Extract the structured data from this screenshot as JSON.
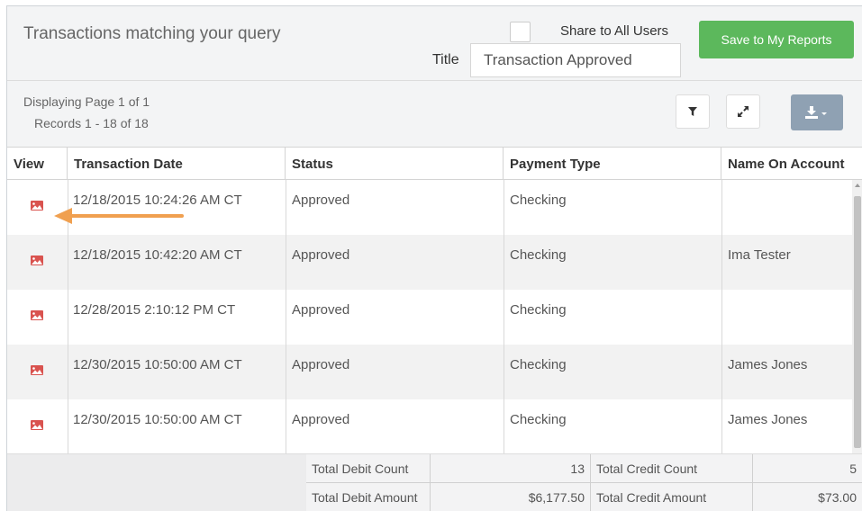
{
  "header": {
    "title": "Transactions matching your query",
    "share_label": "Share to All Users",
    "title_label": "Title",
    "title_value": "Transaction Approved",
    "save_button": "Save to My Reports"
  },
  "pagination": {
    "page_text": "Displaying Page 1 of 1",
    "records_text": "Records 1 - 18 of 18"
  },
  "toolbar": {
    "filter_icon": "filter-icon",
    "expand_icon": "expand-icon",
    "download_icon": "download-icon"
  },
  "table": {
    "columns": [
      "View",
      "Transaction Date",
      "Status",
      "Payment Type",
      "Name On Account"
    ],
    "rows": [
      {
        "date": "12/18/2015 10:24:26 AM CT",
        "status": "Approved",
        "payment": "Checking",
        "name": ""
      },
      {
        "date": "12/18/2015 10:42:20 AM CT",
        "status": "Approved",
        "payment": "Checking",
        "name": "Ima Tester"
      },
      {
        "date": "12/28/2015 2:10:12 PM CT",
        "status": "Approved",
        "payment": "Checking",
        "name": ""
      },
      {
        "date": "12/30/2015 10:50:00 AM CT",
        "status": "Approved",
        "payment": "Checking",
        "name": "James Jones"
      },
      {
        "date": "12/30/2015 10:50:00 AM CT",
        "status": "Approved",
        "payment": "Checking",
        "name": "James Jones"
      }
    ]
  },
  "totals": {
    "debit_count_label": "Total Debit Count",
    "debit_count": "13",
    "credit_count_label": "Total Credit Count",
    "credit_count": "5",
    "debit_amount_label": "Total Debit Amount",
    "debit_amount": "$6,177.50",
    "credit_amount_label": "Total Credit Amount",
    "credit_amount": "$73.00"
  },
  "colors": {
    "save_button": "#5cb85c",
    "view_icon": "#d9534f",
    "annotation_arrow": "#f0a050",
    "download_button": "#8fa1b3"
  }
}
